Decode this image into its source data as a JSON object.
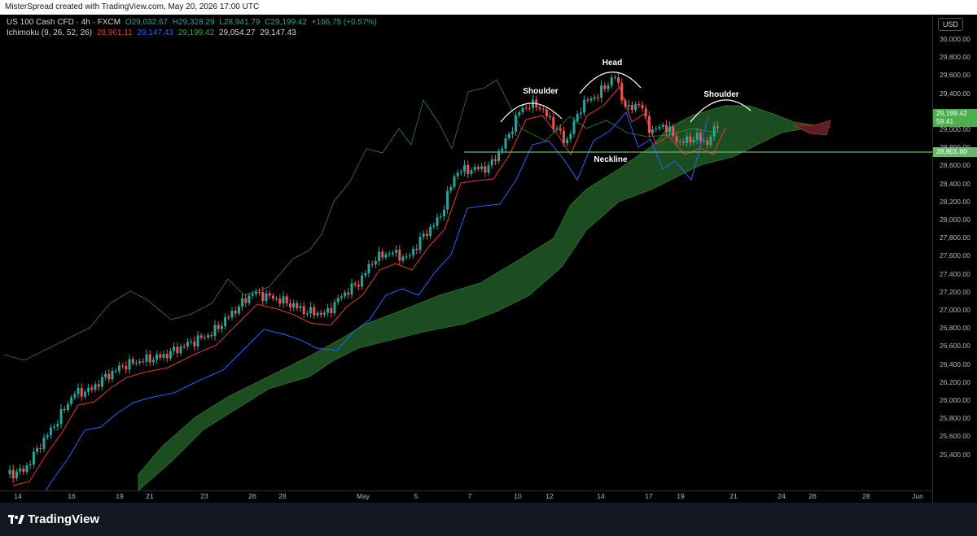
{
  "header": {
    "credit": "MisterSpread created with TradingView.com, May 20, 2026 17:00 UTC"
  },
  "legend": {
    "symbol": "US 100 Cash CFD · 4h · FXCM",
    "open": "O29,032.67",
    "high": "H29,328.29",
    "low": "L28,941.79",
    "close": "C29,199.42",
    "change": "+166.75 (+0.57%)",
    "ichimoku_label": "Ichimoku (9, 26, 52, 26)",
    "ichimoku_values": [
      "28,961.11",
      "29,147.43",
      "29,199.42",
      "29,054.27",
      "29,147.43"
    ]
  },
  "currency_button": "USD",
  "price_axis": {
    "ticks": [
      "30,000.00",
      "29,800.00",
      "29,600.00",
      "29,400.00",
      "29,200.00",
      "29,000.00",
      "28,800.00",
      "28,600.00",
      "28,400.00",
      "28,200.00",
      "28,000.00",
      "27,800.00",
      "27,600.00",
      "27,400.00",
      "27,200.00",
      "27,000.00",
      "26,800.00",
      "26,600.00",
      "26,400.00",
      "26,200.00",
      "26,000.00",
      "25,800.00",
      "25,600.00",
      "25,400.00"
    ],
    "current_price": "29,199.42",
    "countdown": "59:41",
    "neckline_price": "28,801.60"
  },
  "time_axis": {
    "ticks": [
      "14",
      "16",
      "19",
      "21",
      "23",
      "26",
      "28",
      "May",
      "5",
      "7",
      "10",
      "12",
      "14",
      "17",
      "19",
      "21",
      "24",
      "26",
      "28",
      "Jun"
    ]
  },
  "annotations": {
    "left_shoulder": "Shoulder",
    "head": "Head",
    "right_shoulder": "Shoulder",
    "neckline": "Neckline"
  },
  "colors": {
    "bullish": "#26a69a",
    "bearish": "#ef5350",
    "cloud": "#1b4d20",
    "tenkan": "#e53935",
    "kijun": "#2962ff",
    "chikou": "#43a047",
    "neckline": "#66bb6a",
    "current_price_tag": "#4caf50"
  },
  "footer": {
    "brand": "TradingView"
  }
}
